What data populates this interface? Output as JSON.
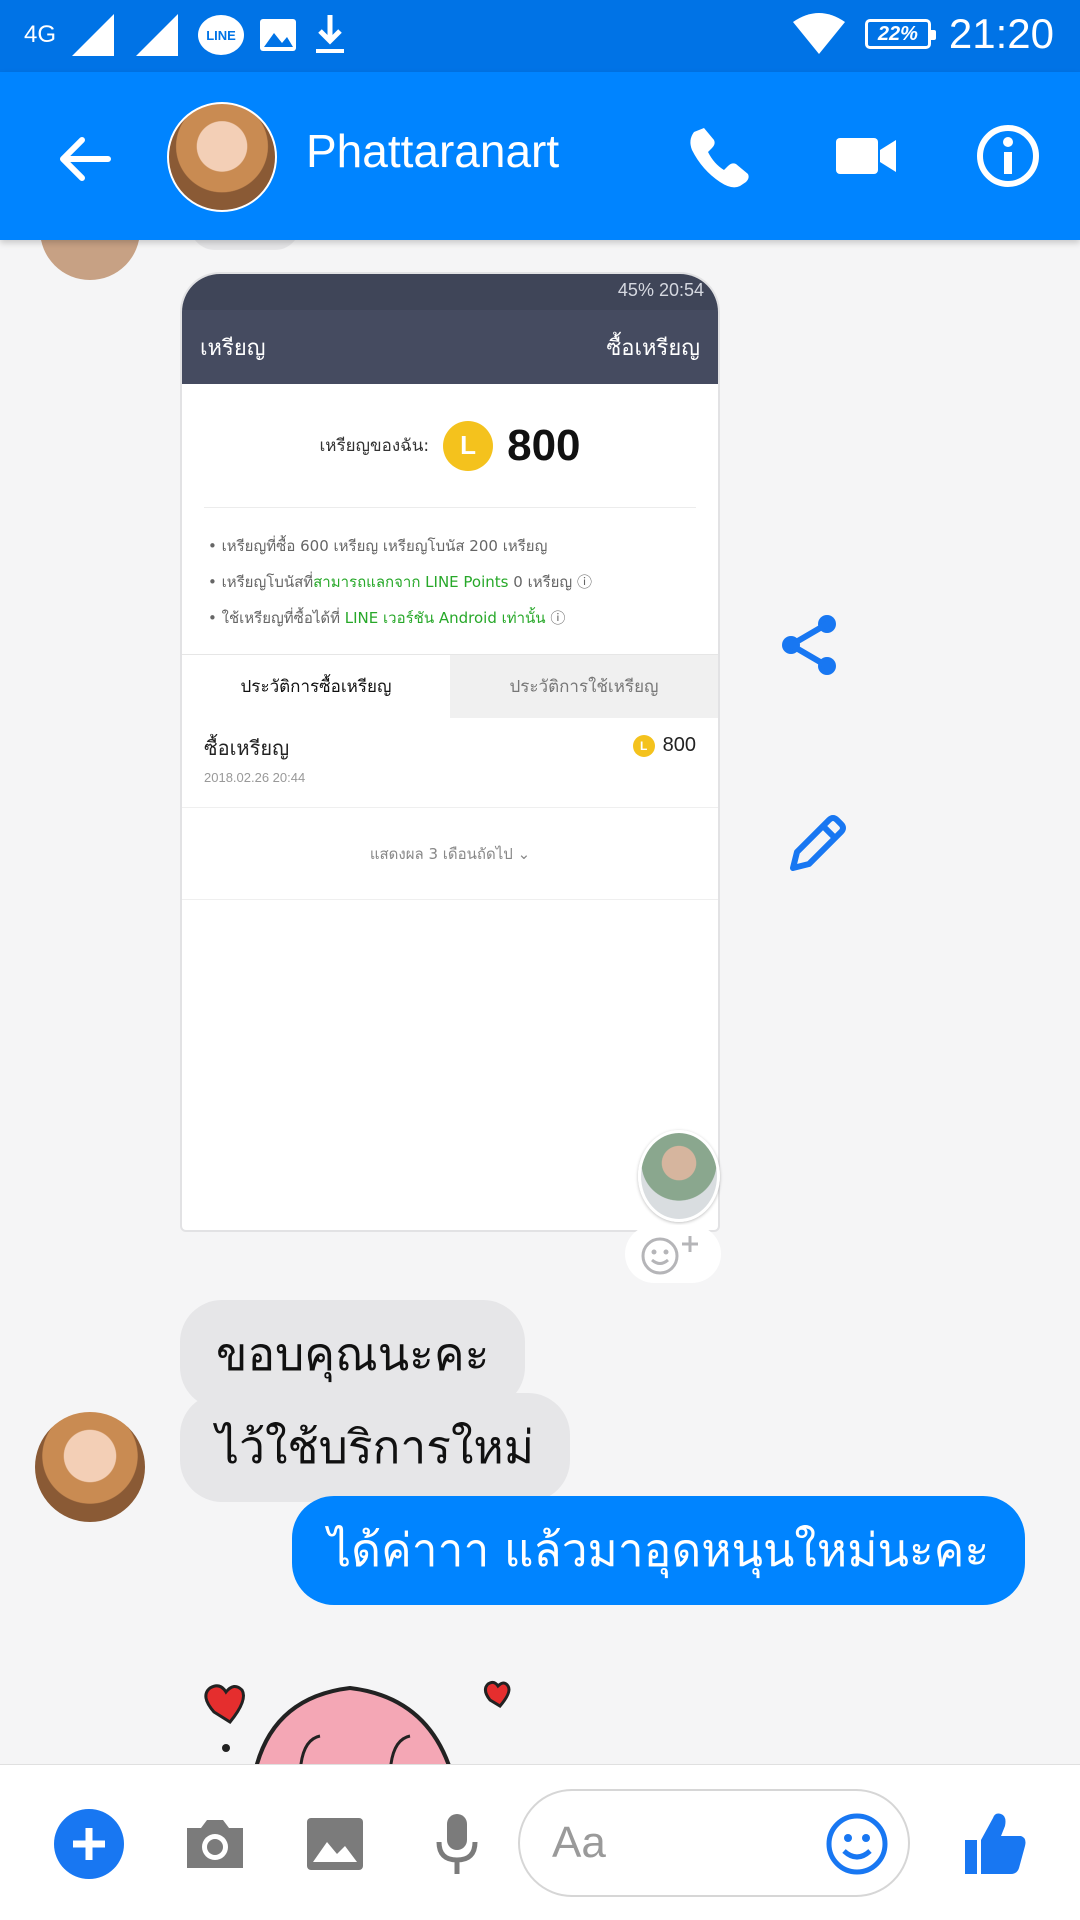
{
  "status_bar": {
    "network": "4G",
    "line_app_label": "LINE",
    "battery": "22%",
    "time": "21:20"
  },
  "header": {
    "contact_name": "Phattaranart"
  },
  "shared_screenshot": {
    "status": "45%  20:54",
    "title": "เหรียญ",
    "buy_label": "ซื้อเหรียญ",
    "balance_label": "เหรียญของฉัน:",
    "coin_letter": "L",
    "balance": "800",
    "notes": [
      "• เหรียญที่ซื้อ 600 เหรียญ เหรียญโบนัส 200 เหรียญ",
      "• เหรียญโบนัสที่",
      "สามารถแลกจาก LINE Points",
      " 0 เหรียญ ⓘ",
      "• ใช้เหรียญที่ซื้อได้ที่ ",
      "LINE เวอร์ชัน Android เท่านั้น",
      " ⓘ"
    ],
    "tabs": [
      "ประวัติการซื้อเหรียญ",
      "ประวัติการใช้เหรียญ"
    ],
    "history_row": {
      "title": "ซื้อเหรียญ",
      "date": "2018.02.26 20:44",
      "amount": "800"
    },
    "show_more": "แสดงผล 3 เดือนถัดไป ⌄"
  },
  "messages": [
    {
      "direction": "in",
      "text": "ขอบคุณนะคะ"
    },
    {
      "direction": "in",
      "text": "ไว้ใช้บริการใหม่"
    },
    {
      "direction": "out",
      "text": "ได้ค่าาา แล้วมาอุดหนุนใหม่นะคะ"
    }
  ],
  "composer": {
    "placeholder": "Aa"
  },
  "colors": {
    "messenger_blue": "#0084ff",
    "status_blue": "#0073e6",
    "bubble_in": "#e6e6e8"
  },
  "icons": [
    "back-arrow-icon",
    "phone-icon",
    "video-call-icon",
    "info-icon",
    "share-icon",
    "edit-pencil-icon",
    "add-icon",
    "camera-icon",
    "gallery-icon",
    "microphone-icon",
    "emoji-icon",
    "thumbs-up-icon"
  ]
}
